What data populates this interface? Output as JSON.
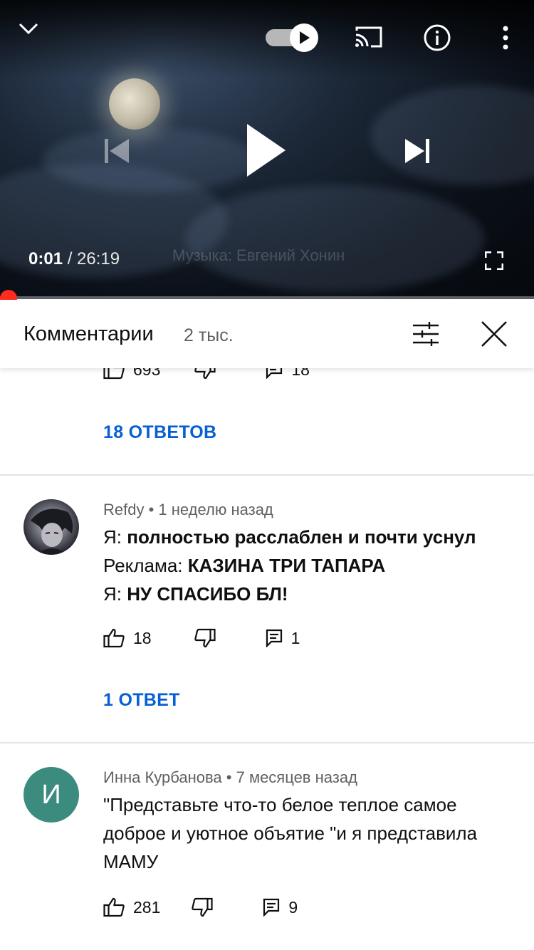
{
  "player": {
    "current_time": "0:01",
    "duration": "/ 26:19",
    "caption": "Музыка: Евгений Хонин",
    "progress_fraction": 0.0006
  },
  "comments_header": {
    "title": "Комментарии",
    "count": "2 тыс."
  },
  "comments": [
    {
      "likes": "693",
      "replies_count": "18",
      "replies_link": "18 ОТВЕТОВ"
    },
    {
      "author": "Refdy",
      "time": "• 1 неделю назад",
      "lines": [
        {
          "prefix": "Я: ",
          "bold": "полностью расслаблен и почти уснул"
        },
        {
          "prefix": "Реклама: ",
          "bold": "КАЗИНА ТРИ ТАПАРА"
        },
        {
          "prefix": "Я: ",
          "bold": "НУ СПАСИБО БЛ!"
        }
      ],
      "likes": "18",
      "replies_count": "1",
      "replies_link": "1 ОТВЕТ"
    },
    {
      "author": "Инна Курбанова",
      "time": "• 7 месяцев назад",
      "avatar_letter": "И",
      "avatar_color": "#3b8c7e",
      "text": "\"Представьте что-то белое теплое самое доброе и уютное объятие \"и я представила МАМУ",
      "likes": "281",
      "replies_count": "9"
    }
  ],
  "colors": {
    "accent_link": "#065fd4",
    "progress": "#ff0000"
  }
}
